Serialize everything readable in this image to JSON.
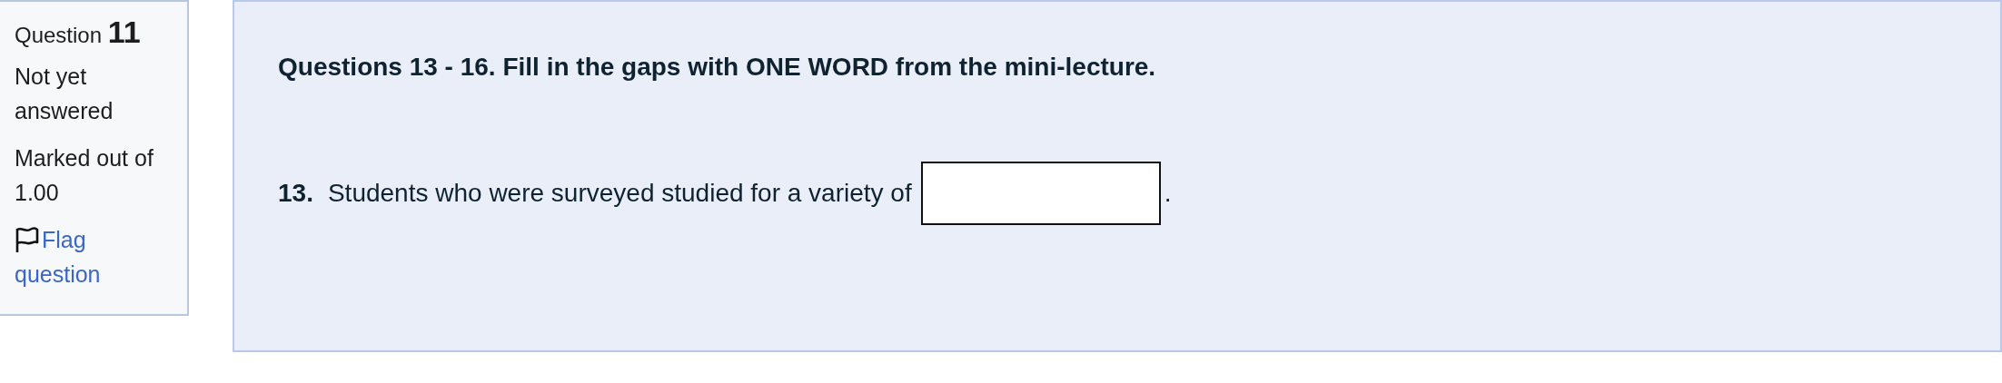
{
  "sidebar": {
    "question_label": "Question",
    "question_number": "11",
    "state": "Not yet answered",
    "marks": "Marked out of 1.00",
    "flag_link": "Flag question"
  },
  "main": {
    "heading": "Questions 13 - 16. Fill in the gaps with ONE WORD from the mini-lecture.",
    "items": [
      {
        "number": "13.",
        "text": "Students who were surveyed studied for a variety of",
        "after": "."
      }
    ]
  }
}
